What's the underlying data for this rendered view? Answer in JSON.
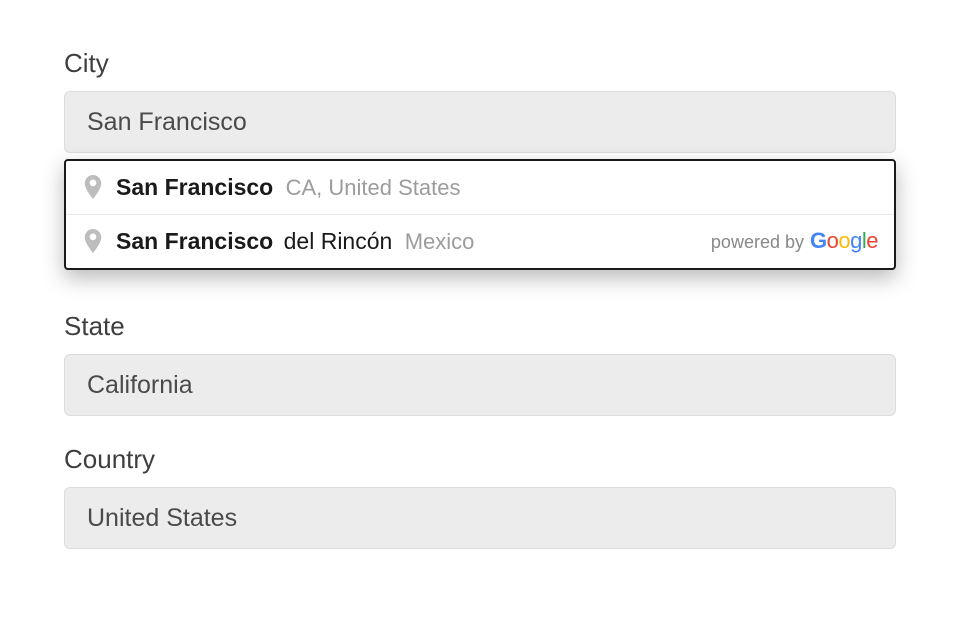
{
  "city": {
    "label": "City",
    "value": "San Francisco"
  },
  "suggestions": [
    {
      "match": "San Francisco",
      "extra": "",
      "secondary": "CA, United States"
    },
    {
      "match": "San Francisco",
      "extra": "del Rincón",
      "secondary": "Mexico"
    }
  ],
  "powered_by": {
    "prefix": "powered by",
    "brand": "Google"
  },
  "state": {
    "label": "State",
    "value": "California"
  },
  "country": {
    "label": "Country",
    "value": "United States"
  }
}
